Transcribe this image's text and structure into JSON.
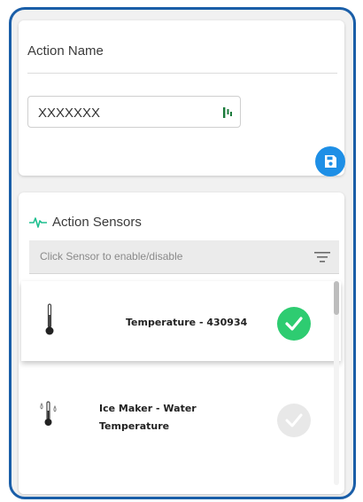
{
  "action_card": {
    "title": "Action Name",
    "name_input_value": "XXXXXXX",
    "save_icon": "floppy-disk-icon"
  },
  "sensors_card": {
    "title": "Action Sensors",
    "title_icon": "pulse-icon",
    "filter_placeholder": "Click Sensor to enable/disable",
    "filter_icon": "filter-lines-icon",
    "sensors": [
      {
        "name": "Temperature - 430934",
        "icon": "thermometer-icon",
        "enabled": true
      },
      {
        "name_line1": "Ice Maker - Water",
        "name_line2": "Temperature",
        "icon": "thermometer-drops-icon",
        "enabled": false
      }
    ]
  },
  "colors": {
    "frame_border": "#1a5ea8",
    "save_button": "#1e8fe6",
    "pulse_green": "#1fbf8f",
    "enabled_check": "#2ecc71",
    "disabled_check": "#e8e8e8"
  }
}
